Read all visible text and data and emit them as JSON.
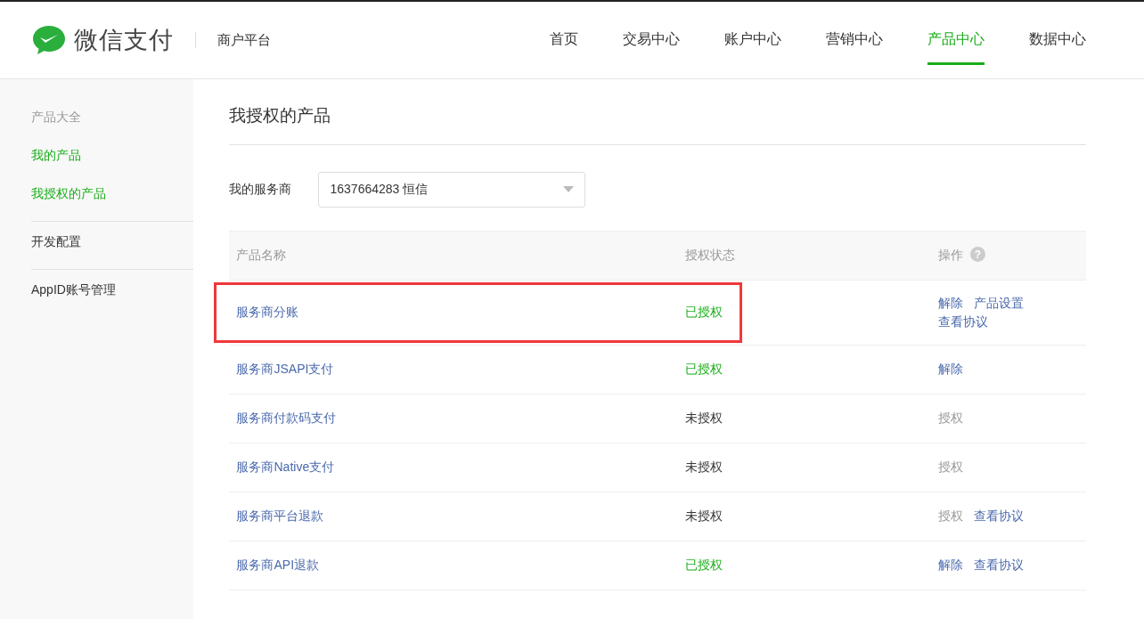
{
  "header": {
    "brand": "微信支付",
    "subtitle": "商户平台",
    "nav": [
      {
        "label": "首页",
        "selected": false
      },
      {
        "label": "交易中心",
        "selected": false
      },
      {
        "label": "账户中心",
        "selected": false
      },
      {
        "label": "营销中心",
        "selected": false
      },
      {
        "label": "产品中心",
        "selected": true
      },
      {
        "label": "数据中心",
        "selected": false
      }
    ]
  },
  "sidebar": {
    "groups": [
      {
        "title": "产品大全",
        "items": [
          {
            "label": "我的产品"
          },
          {
            "label": "我授权的产品"
          }
        ]
      },
      {
        "title": "开发配置"
      },
      {
        "title": "AppID账号管理"
      }
    ]
  },
  "page": {
    "title": "我授权的产品",
    "filter": {
      "label": "我的服务商",
      "value": "1637664283 恒信"
    },
    "table": {
      "columns": [
        "产品名称",
        "授权状态",
        "操作"
      ],
      "help_icon": "?",
      "rows": [
        {
          "name": "服务商分账",
          "status": "已授权",
          "authorized": true,
          "highlighted": true,
          "actions": [
            {
              "label": "解除",
              "disabled": false
            },
            {
              "label": "产品设置",
              "disabled": false
            },
            {
              "label": "查看协议",
              "disabled": false
            }
          ]
        },
        {
          "name": "服务商JSAPI支付",
          "status": "已授权",
          "authorized": true,
          "highlighted": false,
          "actions": [
            {
              "label": "解除",
              "disabled": false
            }
          ]
        },
        {
          "name": "服务商付款码支付",
          "status": "未授权",
          "authorized": false,
          "highlighted": false,
          "actions": [
            {
              "label": "授权",
              "disabled": true
            }
          ]
        },
        {
          "name": "服务商Native支付",
          "status": "未授权",
          "authorized": false,
          "highlighted": false,
          "actions": [
            {
              "label": "授权",
              "disabled": true
            }
          ]
        },
        {
          "name": "服务商平台退款",
          "status": "未授权",
          "authorized": false,
          "highlighted": false,
          "actions": [
            {
              "label": "授权",
              "disabled": true
            },
            {
              "label": "查看协议",
              "disabled": false
            }
          ]
        },
        {
          "name": "服务商API退款",
          "status": "已授权",
          "authorized": true,
          "highlighted": false,
          "actions": [
            {
              "label": "解除",
              "disabled": false
            },
            {
              "label": "查看协议",
              "disabled": false
            }
          ]
        }
      ]
    }
  }
}
